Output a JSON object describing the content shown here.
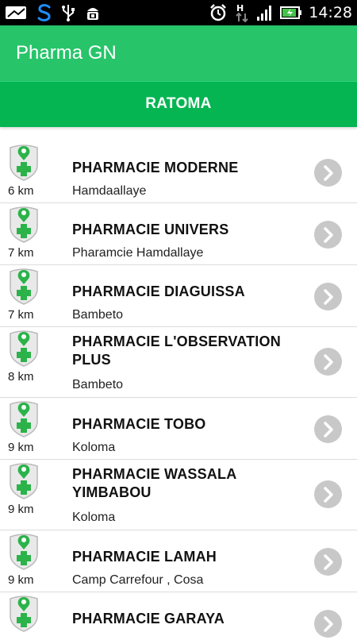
{
  "status_bar": {
    "time": "14:28",
    "icons": [
      "message-icon",
      "sync-s-icon",
      "usb-icon",
      "android-debug-icon",
      "alarm-icon",
      "data-transfer-icon",
      "signal-icon",
      "battery-charging-icon"
    ]
  },
  "app": {
    "title": "Pharma GN",
    "section": "RATOMA"
  },
  "colors": {
    "action_bar": "#27c46a",
    "subheader": "#05b552",
    "accent_green": "#2bb34a",
    "chevron_bg": "#c8c8c8"
  },
  "pharmacies": [
    {
      "name": "PHARMACIE MODERNE",
      "address": "Hamdaallaye",
      "distance": "6 km"
    },
    {
      "name": "PHARMACIE UNIVERS",
      "address": "Pharamcie Hamdallaye",
      "distance": "7 km"
    },
    {
      "name": "PHARMACIE DIAGUISSA",
      "address": "Bambeto",
      "distance": "7 km"
    },
    {
      "name": "PHARMACIE L'OBSERVATION PLUS",
      "address": "Bambeto",
      "distance": "8 km"
    },
    {
      "name": "PHARMACIE TOBO",
      "address": "Koloma",
      "distance": "9 km"
    },
    {
      "name": "PHARMACIE WASSALA YIMBABOU",
      "address": "Koloma",
      "distance": "9 km"
    },
    {
      "name": "PHARMACIE LAMAH",
      "address": "Camp Carrefour , Cosa",
      "distance": "9 km"
    },
    {
      "name": "PHARMACIE GARAYA",
      "address": "",
      "distance": ""
    }
  ]
}
